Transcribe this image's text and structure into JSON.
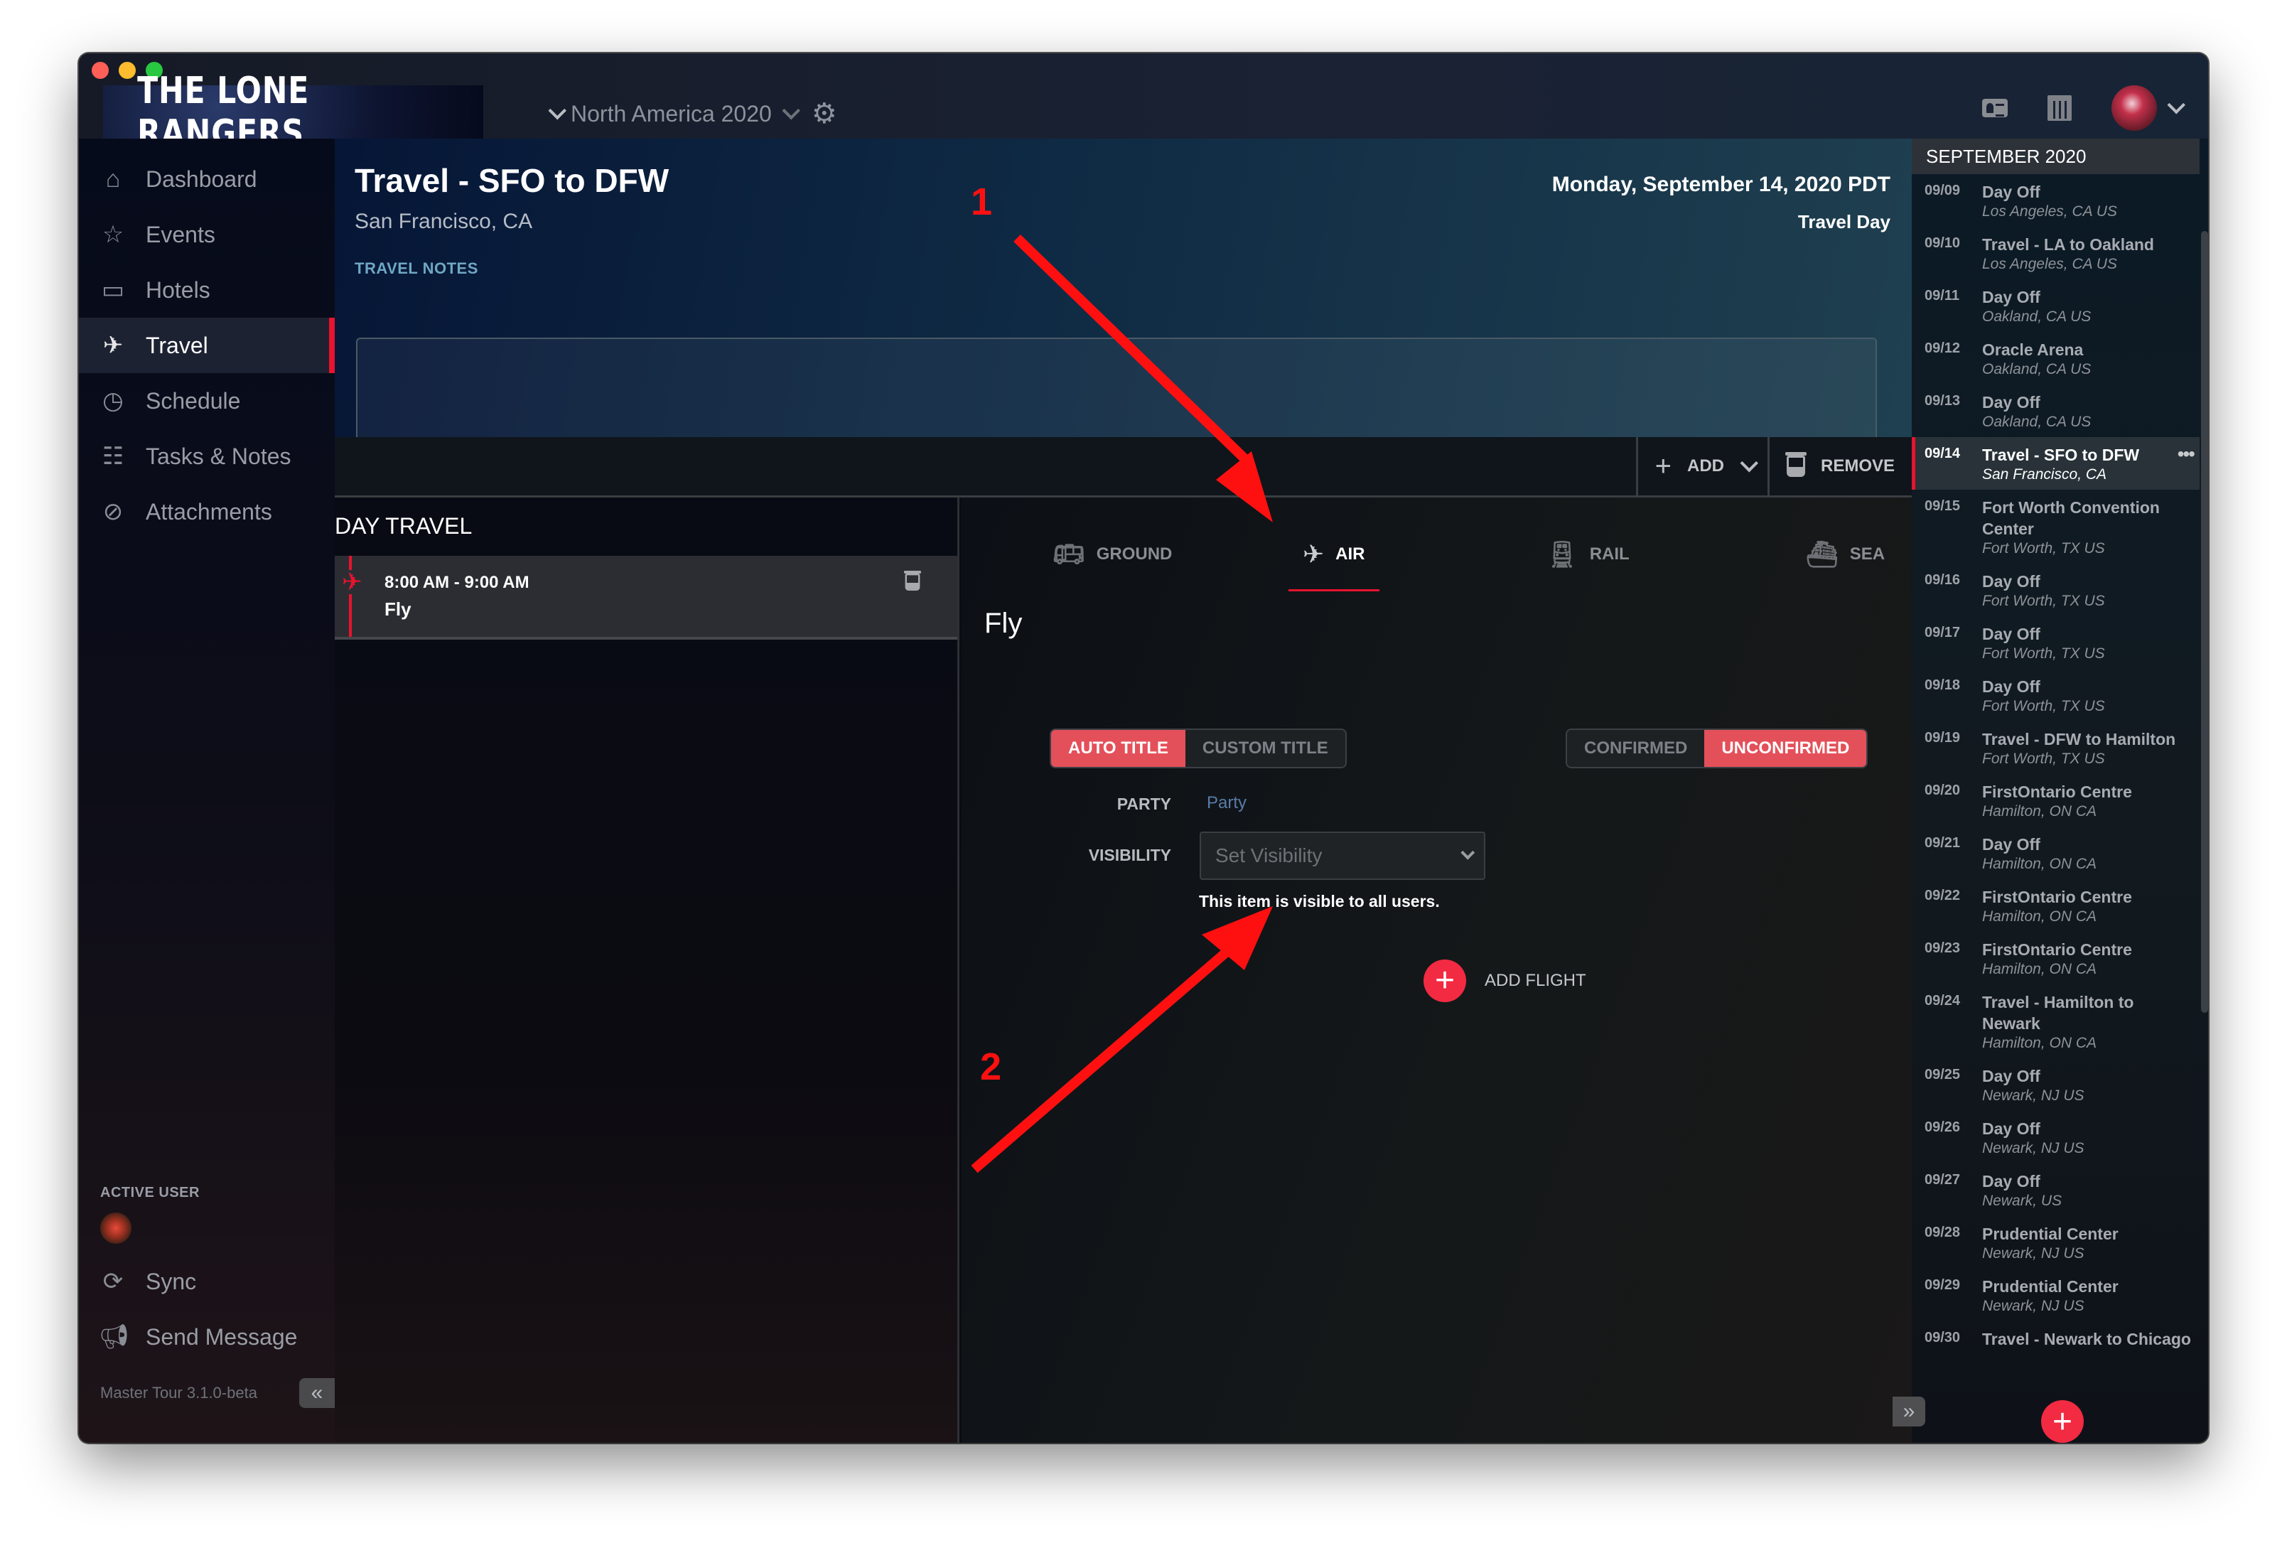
{
  "app": {
    "brand": "THE LONE RANGERS",
    "tour_selector": "North America 2020",
    "version": "Master Tour 3.1.0-beta"
  },
  "topbar": {
    "icons": [
      "contact-card-icon",
      "calendar-icon"
    ]
  },
  "sidebar": {
    "items": [
      {
        "label": "Dashboard",
        "icon": "home-icon",
        "active": false
      },
      {
        "label": "Events",
        "icon": "star-icon",
        "active": false
      },
      {
        "label": "Hotels",
        "icon": "suitcase-icon",
        "active": false
      },
      {
        "label": "Travel",
        "icon": "airplane-icon",
        "active": true
      },
      {
        "label": "Schedule",
        "icon": "clock-icon",
        "active": false
      },
      {
        "label": "Tasks & Notes",
        "icon": "checklist-icon",
        "active": false
      },
      {
        "label": "Attachments",
        "icon": "paperclip-icon",
        "active": false
      }
    ],
    "active_user_label": "ACTIVE USER",
    "sync_label": "Sync",
    "send_message_label": "Send Message"
  },
  "header": {
    "title": "Travel - SFO to DFW",
    "location": "San Francisco, CA",
    "date": "Monday, September 14, 2020 PDT",
    "day_type": "Travel Day",
    "notes_label": "TRAVEL NOTES",
    "notes_value": ""
  },
  "toolbar": {
    "add_label": "ADD",
    "remove_label": "REMOVE"
  },
  "day_travel": {
    "title": "DAY TRAVEL",
    "items": [
      {
        "time": "8:00 AM - 9:00 AM",
        "name": "Fly",
        "type": "air"
      }
    ]
  },
  "detail": {
    "tabs": [
      {
        "label": "GROUND",
        "icon": "bus-icon",
        "active": false
      },
      {
        "label": "AIR",
        "icon": "airplane-icon",
        "active": true
      },
      {
        "label": "RAIL",
        "icon": "train-icon",
        "active": false
      },
      {
        "label": "SEA",
        "icon": "ship-icon",
        "active": false
      }
    ],
    "title": "Fly",
    "title_mode": {
      "options": [
        "AUTO TITLE",
        "CUSTOM TITLE"
      ],
      "selected": "AUTO TITLE"
    },
    "confirmation": {
      "options": [
        "CONFIRMED",
        "UNCONFIRMED"
      ],
      "selected": "UNCONFIRMED"
    },
    "party_label": "PARTY",
    "party_placeholder": "Party",
    "visibility_label": "VISIBILITY",
    "visibility_placeholder": "Set Visibility",
    "visibility_help": "This item is visible to all users.",
    "add_flight_label": "ADD FLIGHT"
  },
  "calendar": {
    "month": "SEPTEMBER 2020",
    "items": [
      {
        "date": "09/09",
        "title": "Day Off",
        "location": "Los Angeles, CA US"
      },
      {
        "date": "09/10",
        "title": "Travel - LA to Oakland",
        "location": "Los Angeles, CA US"
      },
      {
        "date": "09/11",
        "title": "Day Off",
        "location": "Oakland, CA US"
      },
      {
        "date": "09/12",
        "title": "Oracle Arena",
        "location": "Oakland, CA US"
      },
      {
        "date": "09/13",
        "title": "Day Off",
        "location": "Oakland, CA US"
      },
      {
        "date": "09/14",
        "title": "Travel - SFO to DFW",
        "location": "San Francisco, CA",
        "active": true
      },
      {
        "date": "09/15",
        "title": "Fort Worth Convention Center",
        "location": "Fort Worth, TX US"
      },
      {
        "date": "09/16",
        "title": "Day Off",
        "location": "Fort Worth, TX US"
      },
      {
        "date": "09/17",
        "title": "Day Off",
        "location": "Fort Worth, TX US"
      },
      {
        "date": "09/18",
        "title": "Day Off",
        "location": "Fort Worth, TX US"
      },
      {
        "date": "09/19",
        "title": "Travel - DFW to Hamilton",
        "location": "Fort Worth, TX US"
      },
      {
        "date": "09/20",
        "title": "FirstOntario Centre",
        "location": "Hamilton, ON CA"
      },
      {
        "date": "09/21",
        "title": "Day Off",
        "location": "Hamilton, ON CA"
      },
      {
        "date": "09/22",
        "title": "FirstOntario Centre",
        "location": "Hamilton, ON CA"
      },
      {
        "date": "09/23",
        "title": "FirstOntario Centre",
        "location": "Hamilton, ON CA"
      },
      {
        "date": "09/24",
        "title": "Travel - Hamilton to Newark",
        "location": "Hamilton, ON CA"
      },
      {
        "date": "09/25",
        "title": "Day Off",
        "location": "Newark, NJ US"
      },
      {
        "date": "09/26",
        "title": "Day Off",
        "location": "Newark, NJ US"
      },
      {
        "date": "09/27",
        "title": "Day Off",
        "location": "Newark, US"
      },
      {
        "date": "09/28",
        "title": "Prudential Center",
        "location": "Newark, NJ US"
      },
      {
        "date": "09/29",
        "title": "Prudential Center",
        "location": "Newark, NJ US"
      },
      {
        "date": "09/30",
        "title": "Travel - Newark to Chicago",
        "location": ""
      }
    ]
  },
  "annotations": [
    {
      "label": "1",
      "points_to": "AIR tab"
    },
    {
      "label": "2",
      "points_to": "ADD FLIGHT button"
    }
  ],
  "colors": {
    "accent": "#e8132f",
    "toggle_on": "#e4505a",
    "fab": "#f22a42",
    "annotation": "#ff1010"
  }
}
